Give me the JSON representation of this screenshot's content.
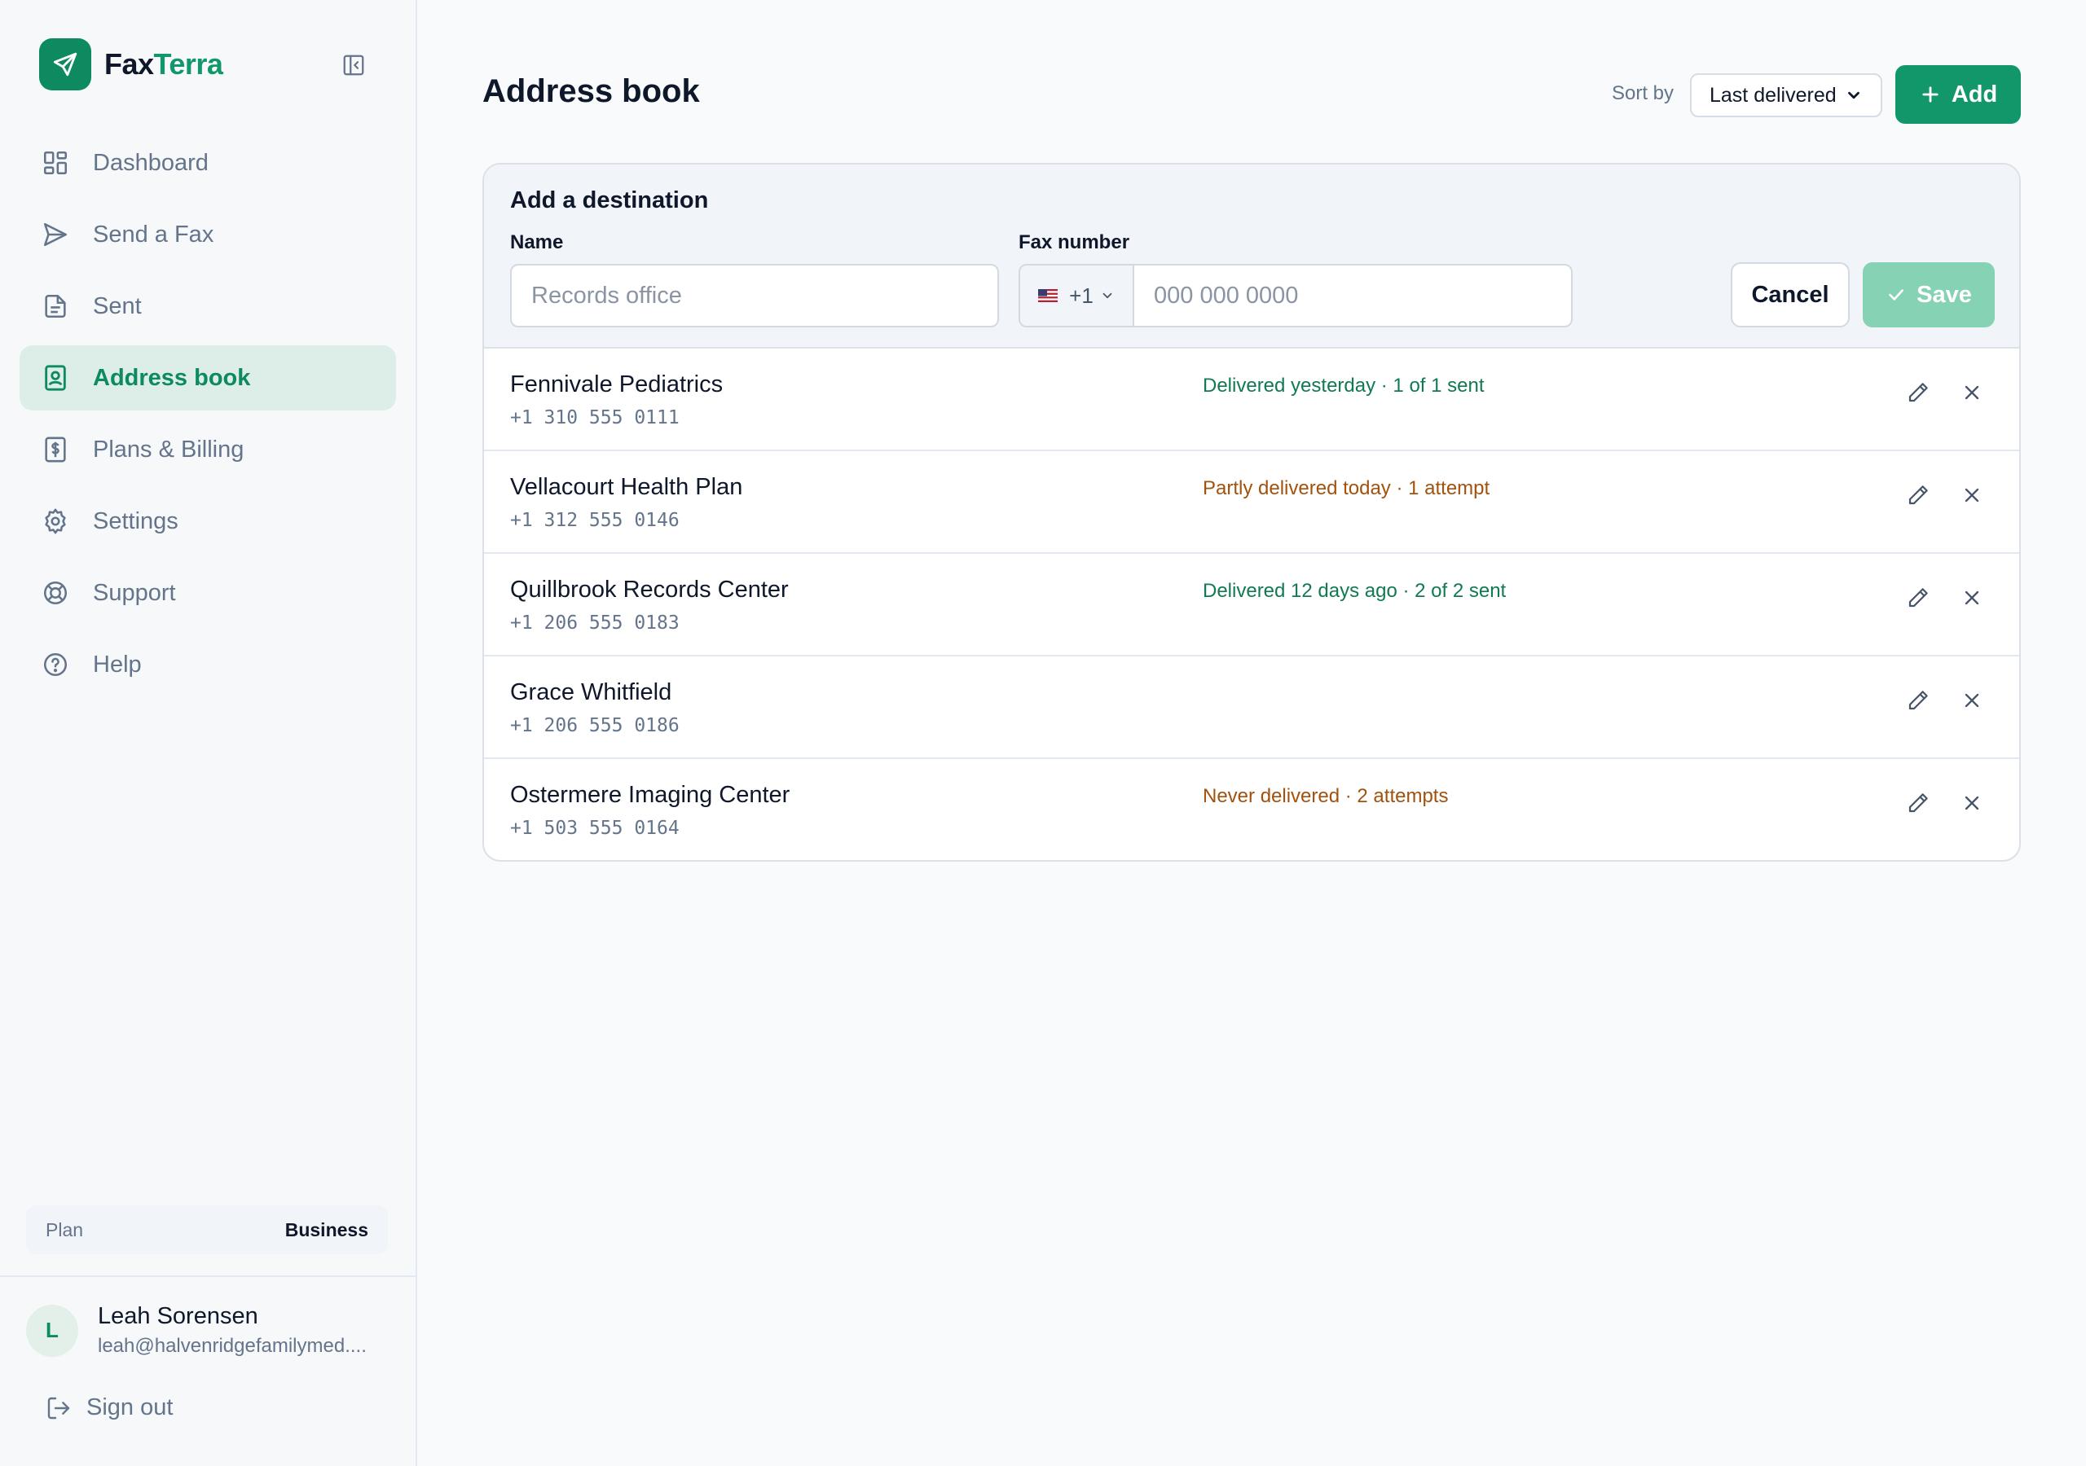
{
  "brand": {
    "name_part1": "Fax",
    "name_part2": "Terra"
  },
  "sidebar": {
    "items": [
      {
        "label": "Dashboard",
        "icon": "grid-icon"
      },
      {
        "label": "Send a Fax",
        "icon": "send-icon"
      },
      {
        "label": "Sent",
        "icon": "document-icon"
      },
      {
        "label": "Address book",
        "icon": "contact-book-icon",
        "active": true
      },
      {
        "label": "Plans & Billing",
        "icon": "billing-icon"
      },
      {
        "label": "Settings",
        "icon": "gear-icon"
      },
      {
        "label": "Support",
        "icon": "lifebuoy-icon"
      },
      {
        "label": "Help",
        "icon": "question-icon"
      }
    ],
    "plan": {
      "label": "Plan",
      "value": "Business"
    },
    "user": {
      "initial": "L",
      "name": "Leah Sorensen",
      "email": "leah@halvenridgefamilymed...."
    },
    "sign_out": "Sign out"
  },
  "main": {
    "title": "Address book",
    "sort": {
      "label": "Sort by",
      "value": "Last delivered"
    },
    "add_button": "Add",
    "form": {
      "title": "Add a destination",
      "name_label": "Name",
      "name_placeholder": "Records office",
      "fax_label": "Fax number",
      "country_code": "+1",
      "fax_placeholder": "000 000 0000",
      "cancel": "Cancel",
      "save": "Save"
    },
    "contacts": [
      {
        "name": "Fennivale Pediatrics",
        "number": "+1 310 555 0111",
        "status": "Delivered yesterday · 1 of 1 sent",
        "status_type": "good"
      },
      {
        "name": "Vellacourt Health Plan",
        "number": "+1 312 555 0146",
        "status": "Partly delivered today · 1 attempt",
        "status_type": "warn"
      },
      {
        "name": "Quillbrook Records Center",
        "number": "+1 206 555 0183",
        "status": "Delivered 12 days ago · 2 of 2 sent",
        "status_type": "good"
      },
      {
        "name": "Grace Whitfield",
        "number": "+1 206 555 0186",
        "status": "",
        "status_type": "none"
      },
      {
        "name": "Ostermere Imaging Center",
        "number": "+1 503 555 0164",
        "status": "Never delivered · 2 attempts",
        "status_type": "warn"
      }
    ]
  },
  "colors": {
    "accent": "#11976a",
    "good": "#117a52",
    "warn": "#a3520d"
  }
}
